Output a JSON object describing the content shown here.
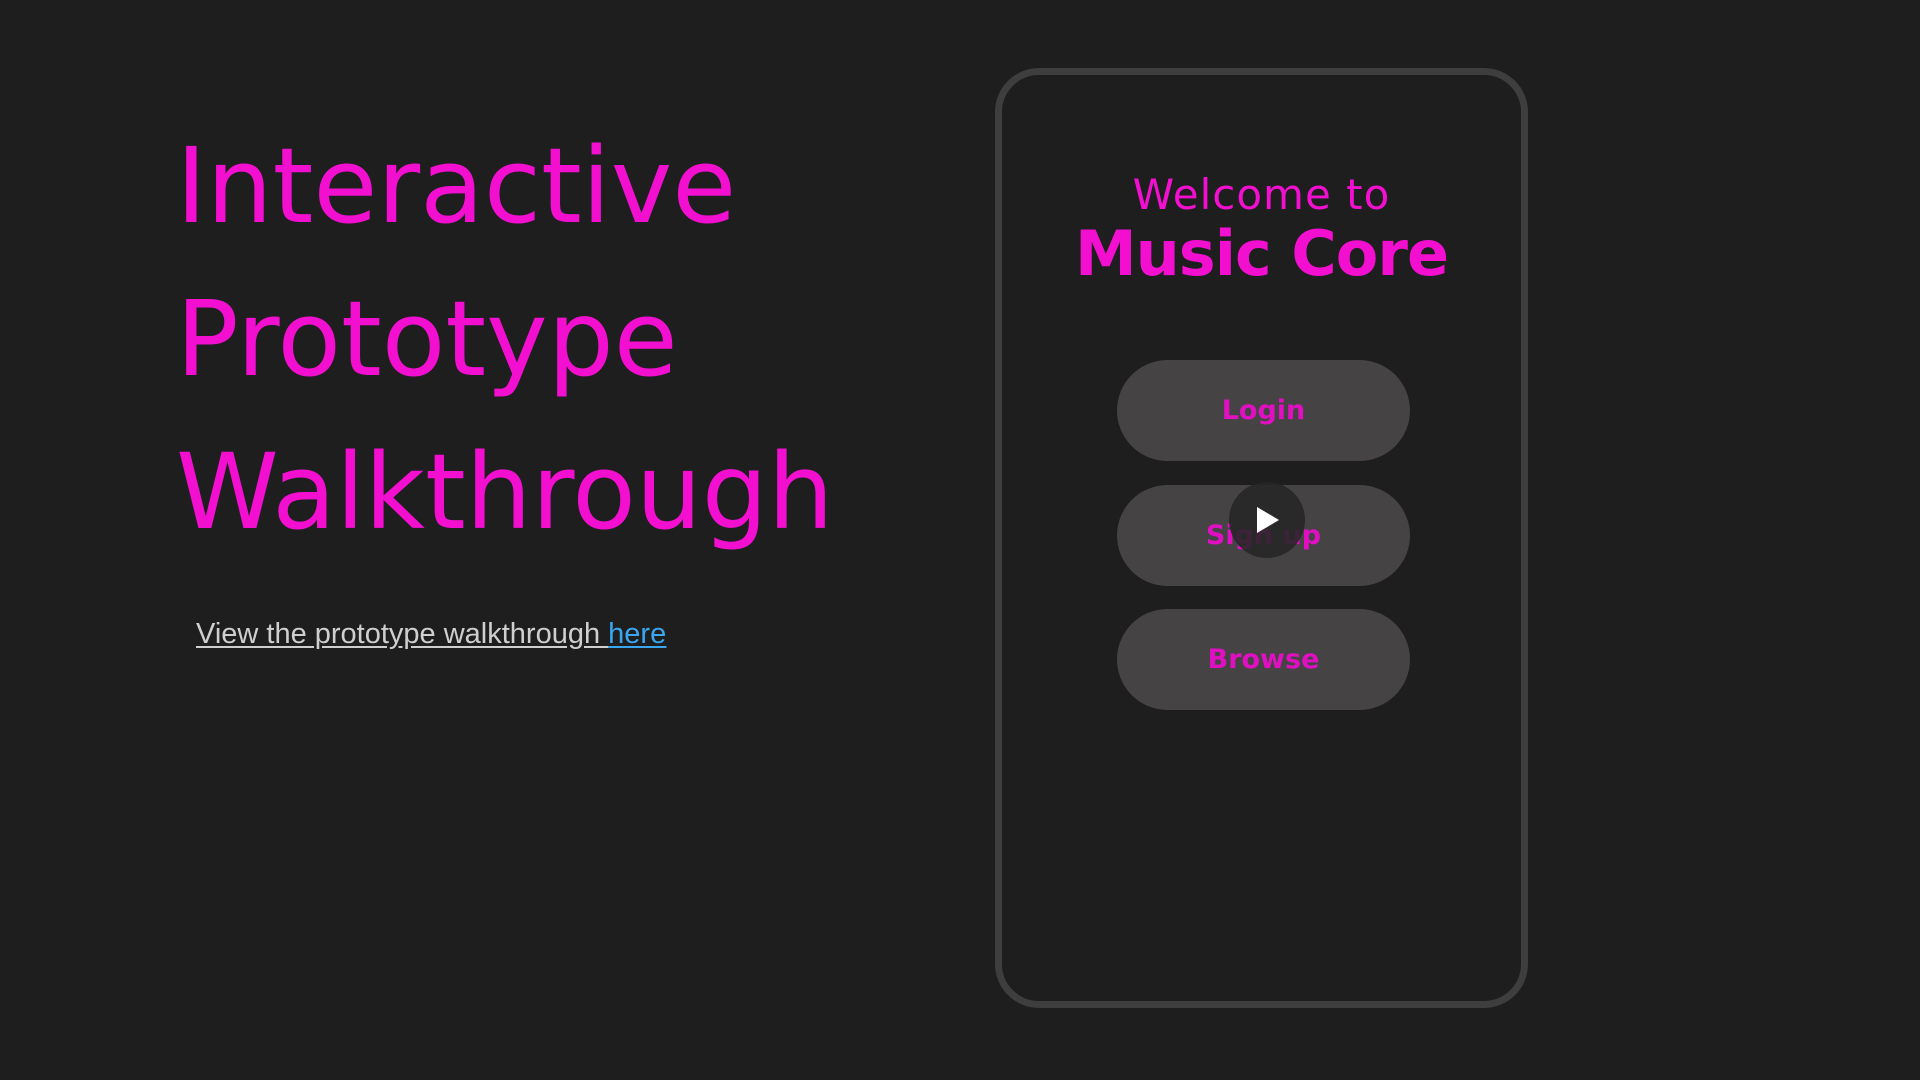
{
  "slide": {
    "title_lines": [
      "Interactive",
      "Prototype",
      "Walkthrough"
    ],
    "caption_text": "View the prototype walkthrough ",
    "caption_link": "here"
  },
  "phone": {
    "welcome": "Welcome to",
    "app_name": "Music Core",
    "buttons": {
      "login": "Login",
      "signup": "Sign up",
      "browse": "Browse"
    }
  },
  "video": {
    "icon": "play-icon"
  },
  "colors": {
    "background": "#1e1e1e",
    "accent": "#f20fd0",
    "button_fill": "#454344",
    "link": "#3aa6f0",
    "frame": "#3e3e3e"
  }
}
